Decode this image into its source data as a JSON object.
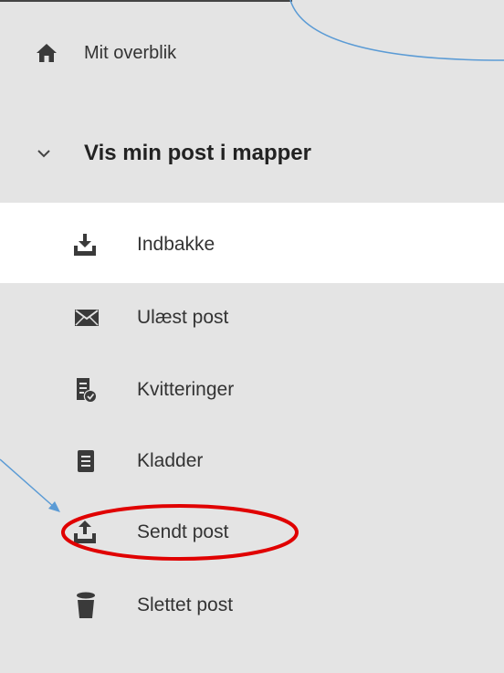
{
  "overview": {
    "label": "Mit overblik",
    "icon": "home-icon"
  },
  "folders_header": {
    "label": "Vis min post i mapper",
    "icon": "chevron-down-icon"
  },
  "folders": [
    {
      "label": "Indbakke",
      "icon": "inbox-download-icon"
    },
    {
      "label": "Ulæst post",
      "icon": "envelope-icon"
    },
    {
      "label": "Kvitteringer",
      "icon": "receipt-check-icon"
    },
    {
      "label": "Kladder",
      "icon": "draft-document-icon"
    },
    {
      "label": "Sendt post",
      "icon": "outbox-upload-icon"
    },
    {
      "label": "Slettet post",
      "icon": "trash-icon"
    }
  ],
  "colors": {
    "sidebar_gray": "#e4e4e4",
    "selected_row": "#ffffff",
    "icon": "#3a3a3a",
    "annotation_blue": "#5b9bd5",
    "highlight_red": "#e00000"
  }
}
